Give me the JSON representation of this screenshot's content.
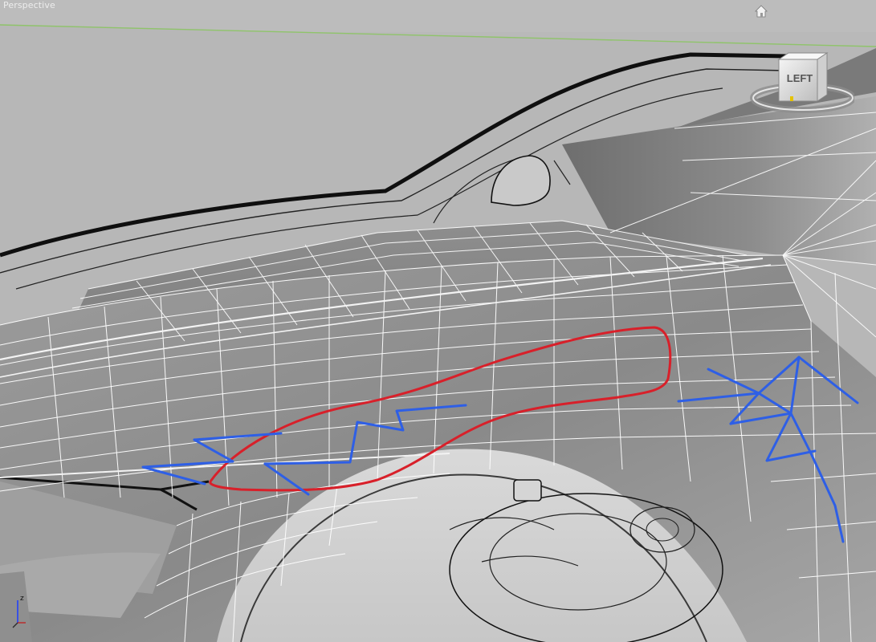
{
  "viewport": {
    "label": "Perspective",
    "home_icon": "home-icon",
    "viewcube": {
      "face_label": "LEFT",
      "icon": "viewcube-icon"
    },
    "axis": {
      "z_label": "z",
      "icon": "axis-tripod-icon"
    }
  },
  "annotations": {
    "red_outline": {
      "color": "#d8202a",
      "meaning": "freehand-outline"
    },
    "blue_strokes": {
      "color": "#2e5fe6",
      "meaning": "edge-flow-sketch"
    }
  },
  "colors": {
    "background": "#b9b9b9",
    "wire": "#ffffff",
    "outline": "#111111",
    "horizon_line": "#8fc46a"
  }
}
